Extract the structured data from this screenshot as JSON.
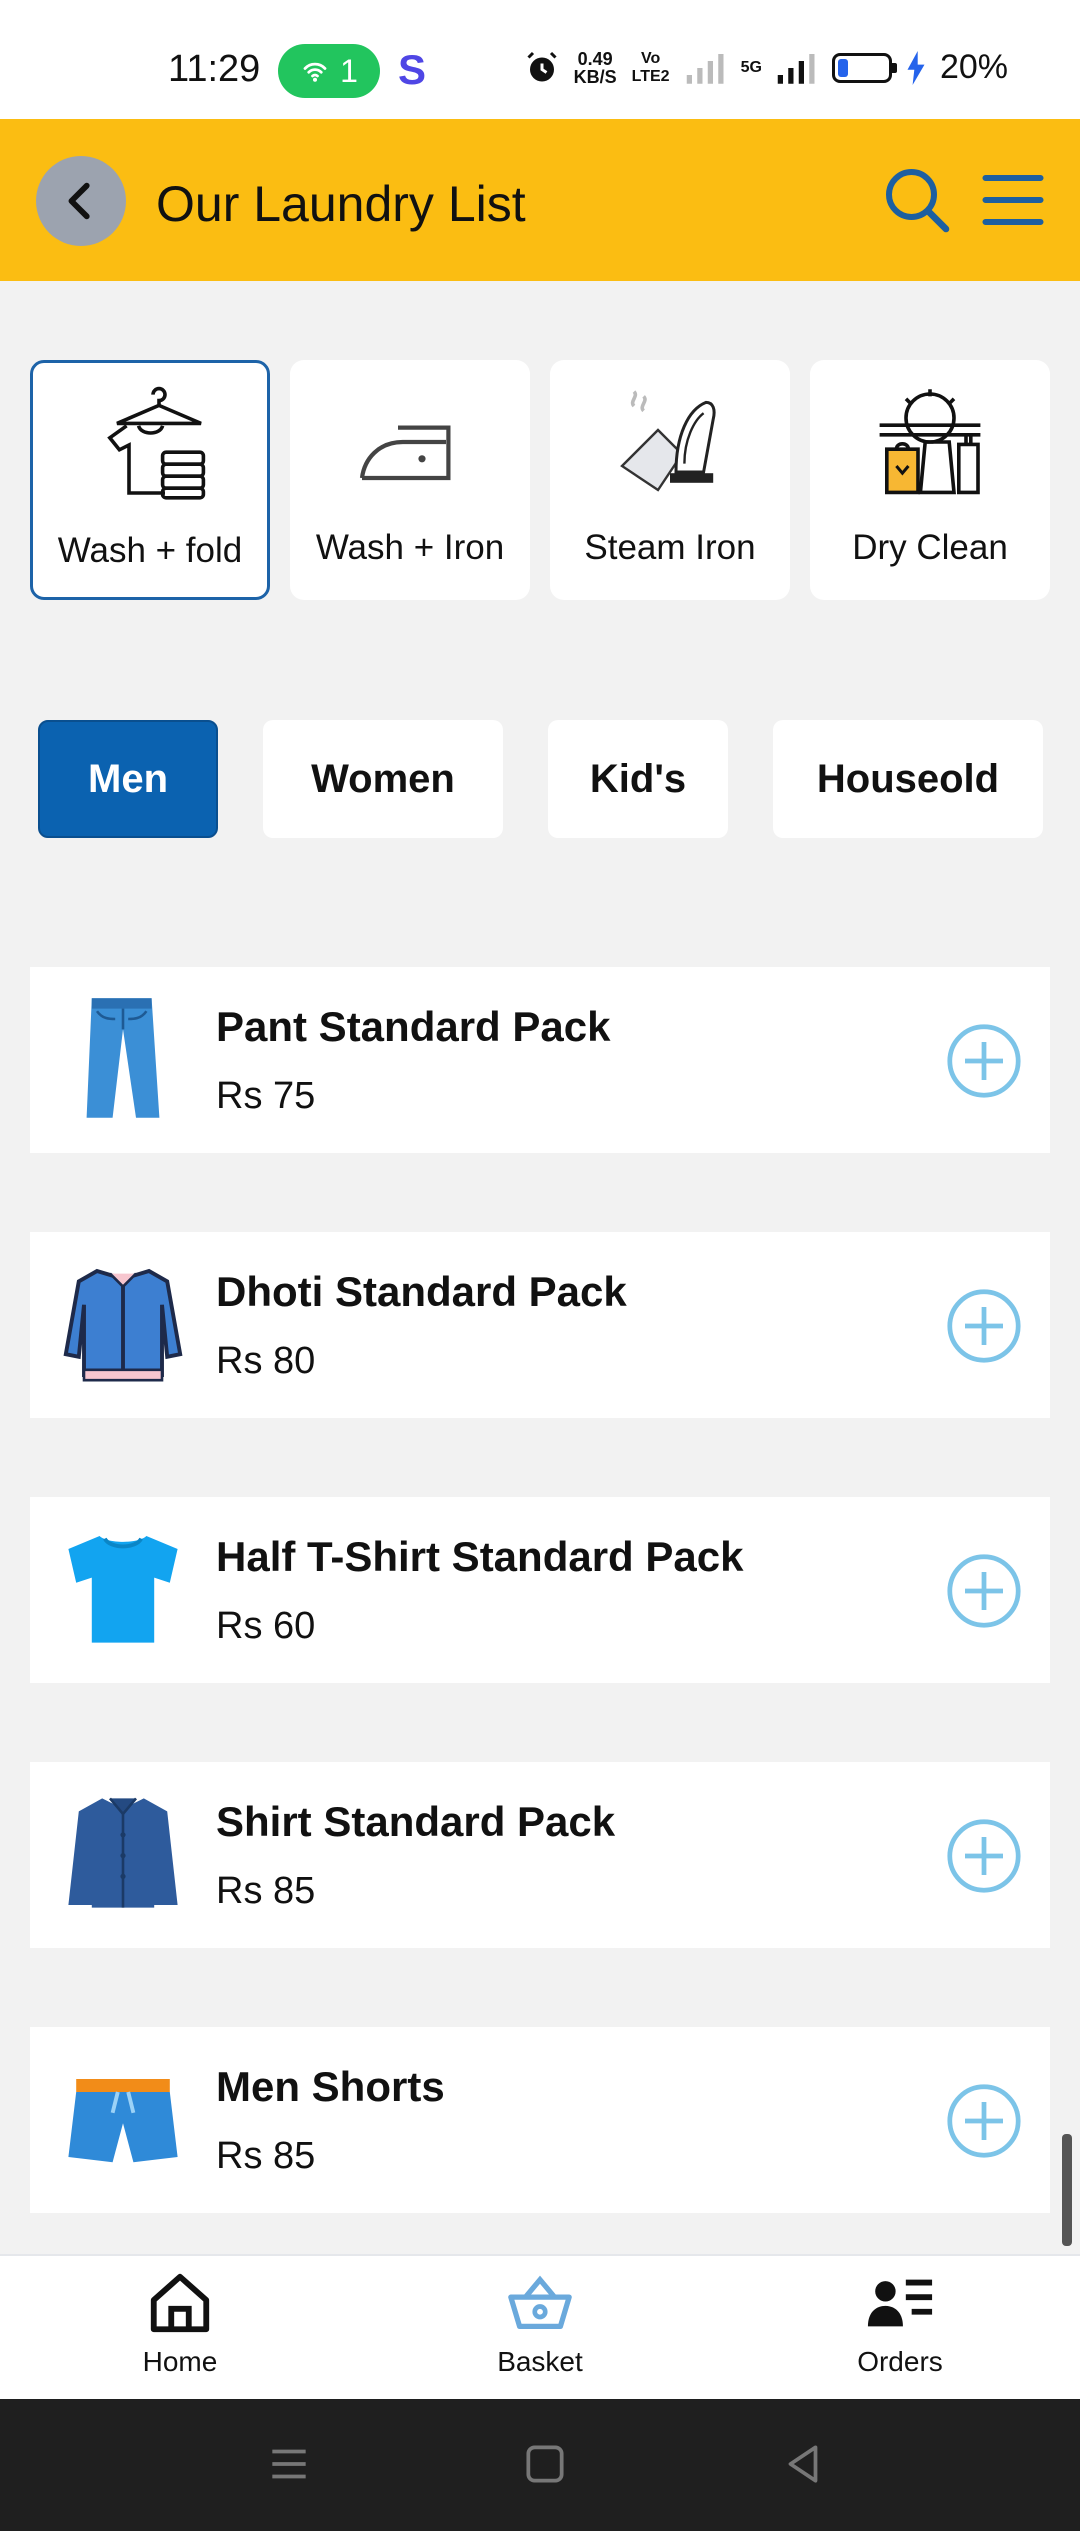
{
  "status_bar": {
    "time": "11:29",
    "hotspot_count": "1",
    "app_badge": "S",
    "net_speed_value": "0.49",
    "net_speed_unit": "KB/S",
    "volte_label": "Vo LTE2",
    "network_label": "5G",
    "battery_percent": "20%",
    "battery_level": 0.2
  },
  "app_bar": {
    "title": "Our Laundry List",
    "accent": "#fbbd12"
  },
  "services": [
    {
      "label": "Wash + fold",
      "icon": "tshirt-hanger-folded-clothes-icon",
      "selected": true
    },
    {
      "label": "Wash + Iron",
      "icon": "iron-icon",
      "selected": false
    },
    {
      "label": "Steam Iron",
      "icon": "steam-iron-icon",
      "selected": false
    },
    {
      "label": "Dry Clean",
      "icon": "dry-clean-icon",
      "selected": false
    }
  ],
  "categories": [
    {
      "label": "Men",
      "selected": true
    },
    {
      "label": "Women",
      "selected": false
    },
    {
      "label": "Kid's",
      "selected": false
    },
    {
      "label": "Houseold",
      "selected": false
    }
  ],
  "items": [
    {
      "name": "Pant Standard Pack",
      "price": "Rs 75",
      "icon": "jeans-icon"
    },
    {
      "name": "Dhoti Standard Pack",
      "price": "Rs 80",
      "icon": "jacket-icon"
    },
    {
      "name": "Half T-Shirt Standard Pack",
      "price": "Rs 60",
      "icon": "tshirt-icon"
    },
    {
      "name": "Shirt Standard Pack",
      "price": "Rs 85",
      "icon": "shirt-icon"
    },
    {
      "name": "Men Shorts",
      "price": "Rs 85",
      "icon": "shorts-icon"
    }
  ],
  "bottom_nav": [
    {
      "label": "Home",
      "icon": "home-icon"
    },
    {
      "label": "Basket",
      "icon": "basket-icon"
    },
    {
      "label": "Orders",
      "icon": "orders-icon"
    }
  ],
  "colors": {
    "primary_blue": "#0b62b0",
    "add_icon": "#7cc4e8",
    "background": "#f2f2f2"
  }
}
